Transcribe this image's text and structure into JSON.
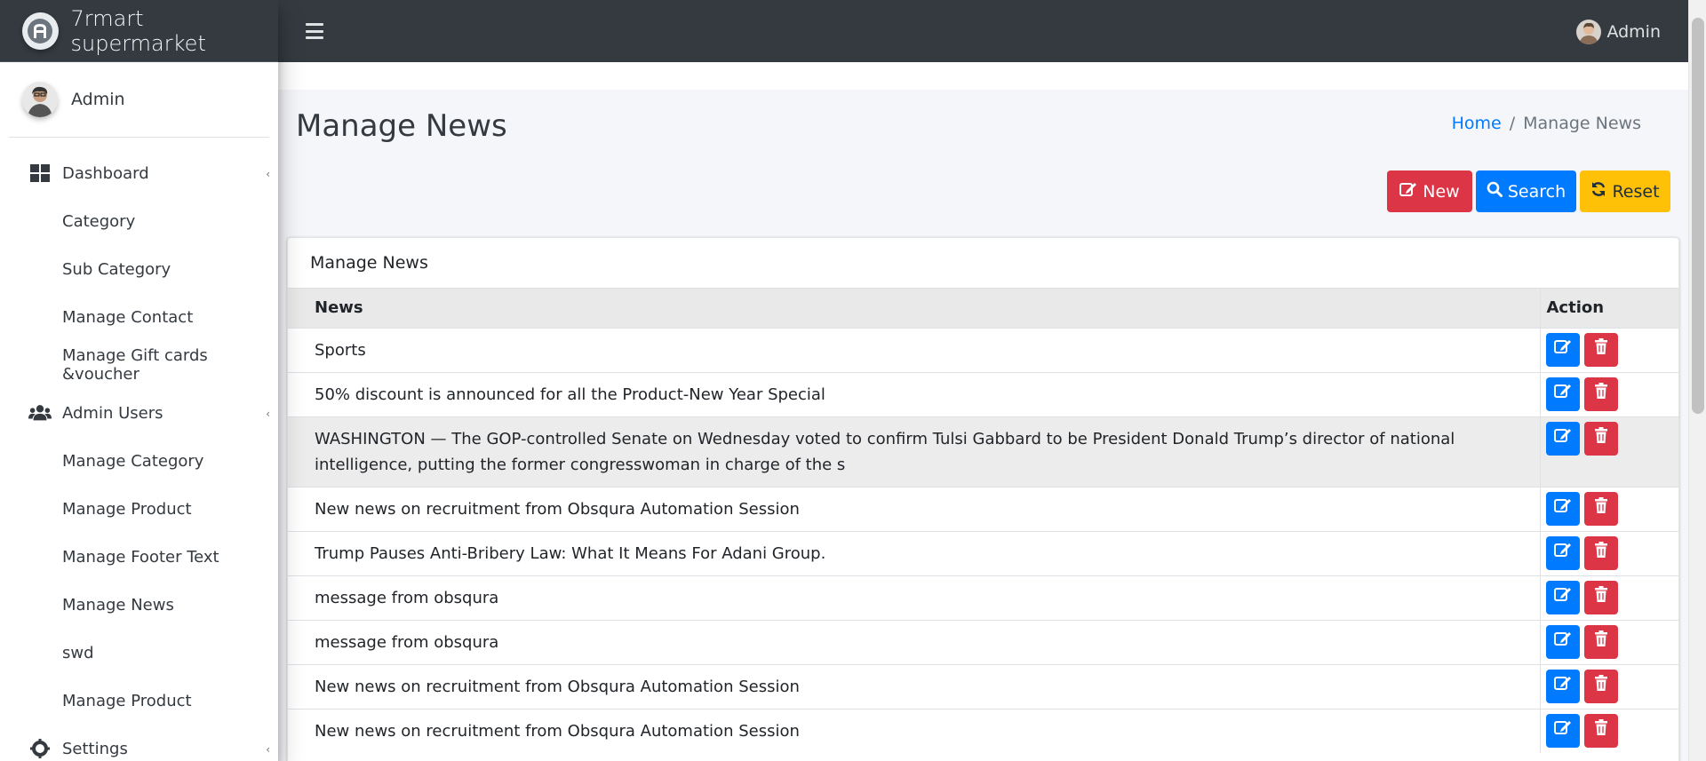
{
  "brand": {
    "name": "7rmart supermarket",
    "logo_icon": "brand-logo-icon"
  },
  "user_panel": {
    "name": "Admin"
  },
  "navbar": {
    "user_name": "Admin"
  },
  "sidebar": {
    "items": [
      {
        "label": "Dashboard",
        "icon": "dashboard-icon",
        "level": "top",
        "caret": "‹"
      },
      {
        "label": "Category",
        "level": "sub"
      },
      {
        "label": "Sub Category",
        "level": "sub"
      },
      {
        "label": "Manage Contact",
        "level": "sub"
      },
      {
        "label": "Manage Gift cards &voucher",
        "level": "sub"
      },
      {
        "label": "Admin Users",
        "icon": "users-icon",
        "level": "top",
        "caret": "‹"
      },
      {
        "label": "Manage Category",
        "level": "sub"
      },
      {
        "label": "Manage Product",
        "level": "sub"
      },
      {
        "label": "Manage Footer Text",
        "level": "sub"
      },
      {
        "label": "Manage News",
        "level": "sub"
      },
      {
        "label": "swd",
        "level": "sub"
      },
      {
        "label": "Manage Product",
        "level": "sub"
      },
      {
        "label": "Settings",
        "icon": "gear-icon",
        "level": "top",
        "caret": "‹"
      }
    ]
  },
  "page": {
    "title": "Manage News",
    "breadcrumb": {
      "home": "Home",
      "separator": "/",
      "current": "Manage News"
    }
  },
  "toolbar": {
    "new_label": "New",
    "search_label": "Search",
    "reset_label": "Reset"
  },
  "card": {
    "title": "Manage News",
    "columns": [
      "News",
      "Action"
    ],
    "rows": [
      {
        "news": "Sports"
      },
      {
        "news": "50% discount is announced for all the Product-New Year Special"
      },
      {
        "news": "WASHINGTON — The GOP-controlled Senate on Wednesday voted to confirm Tulsi Gabbard to be President Donald Trump’s director of national intelligence, putting the former congresswoman in charge of the s"
      },
      {
        "news": "New news on recruitment from Obsqura Automation Session"
      },
      {
        "news": "Trump Pauses Anti-Bribery Law: What It Means For Adani Group."
      },
      {
        "news": "message from obsqura"
      },
      {
        "news": "message from obsqura"
      },
      {
        "news": "New news on recruitment from Obsqura Automation Session"
      },
      {
        "news": "New news on recruitment from Obsqura Automation Session"
      }
    ]
  },
  "colors": {
    "sidebar_bg": "#ffffff",
    "navbar_bg": "#343a40",
    "primary": "#007bff",
    "danger": "#dc3545",
    "warning": "#ffc107"
  }
}
